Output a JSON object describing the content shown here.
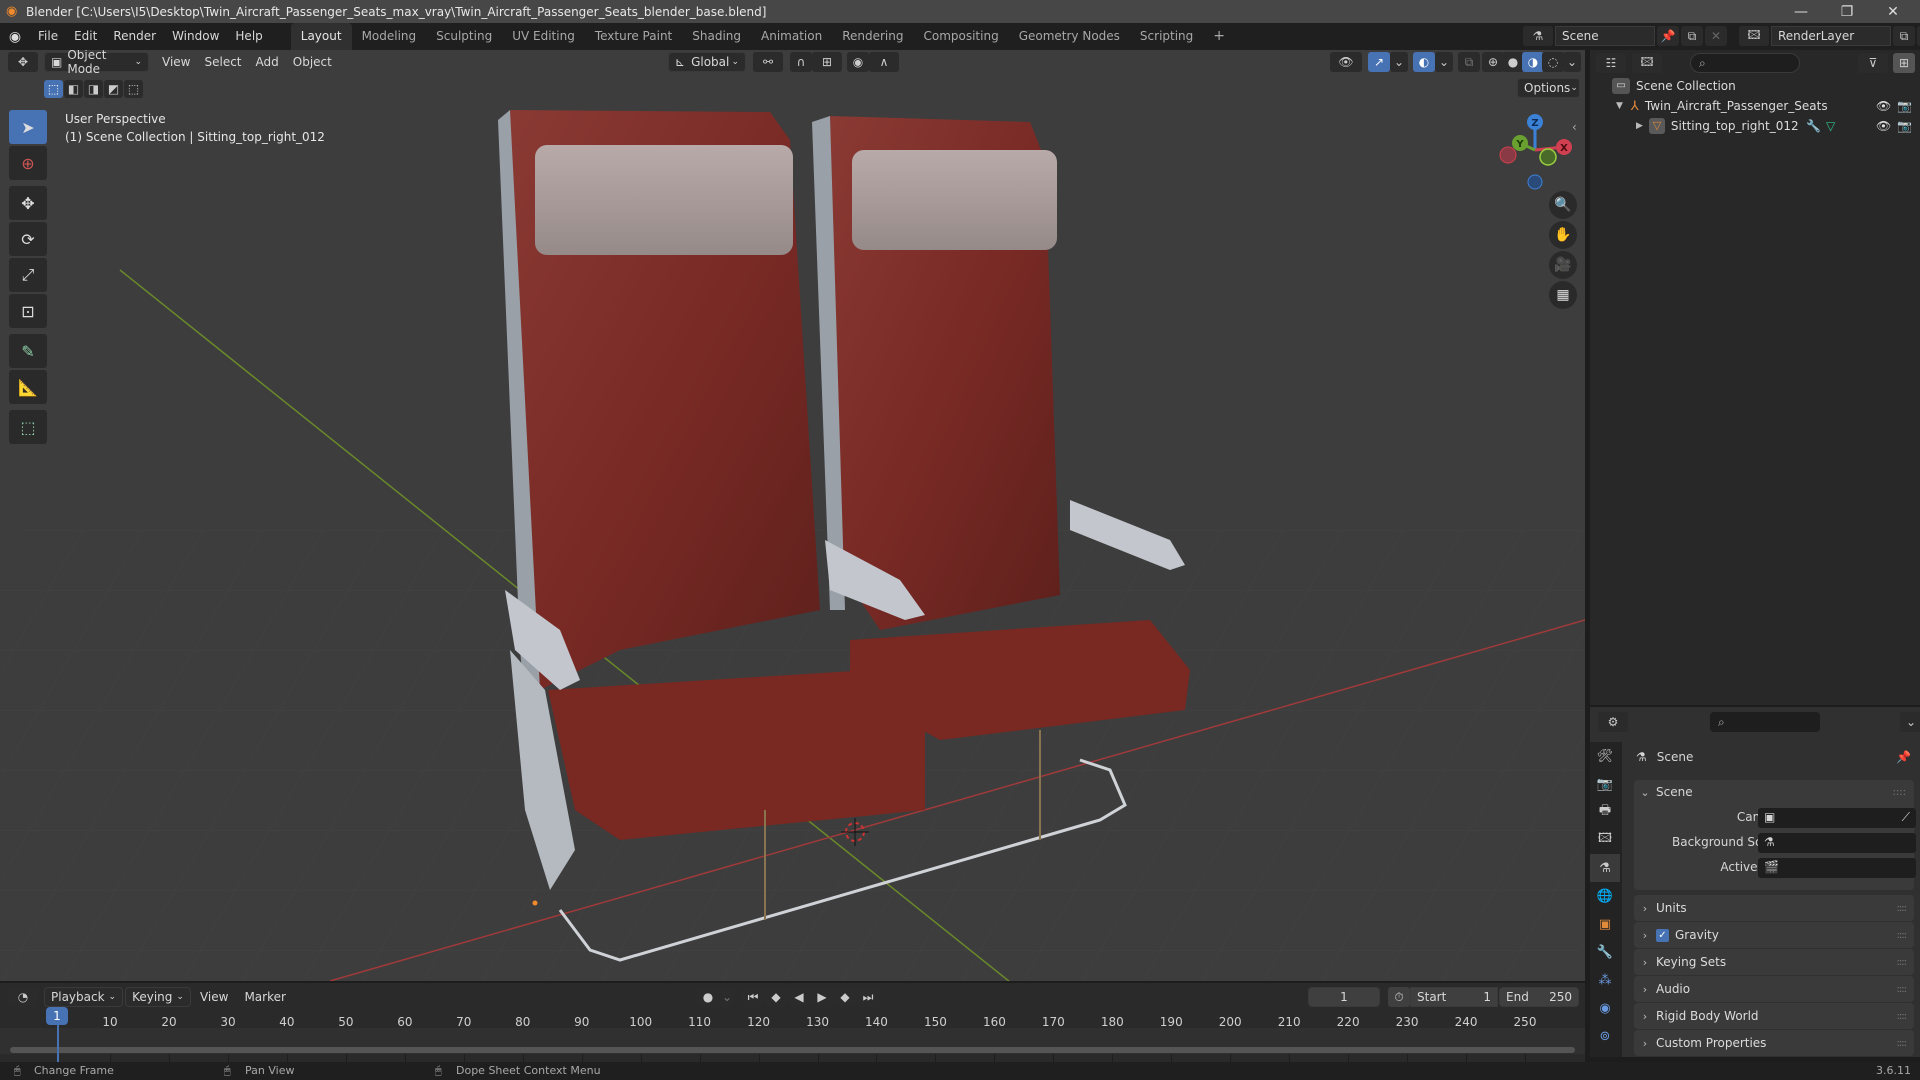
{
  "titlebar": {
    "title": "Blender [C:\\Users\\I5\\Desktop\\Twin_Aircraft_Passenger_Seats_max_vray\\Twin_Aircraft_Passenger_Seats_blender_base.blend]",
    "minimize": "—",
    "maximize": "❐",
    "close": "✕"
  },
  "menubar": {
    "menus": [
      "File",
      "Edit",
      "Render",
      "Window",
      "Help"
    ],
    "workspaces": [
      "Layout",
      "Modeling",
      "Sculpting",
      "UV Editing",
      "Texture Paint",
      "Shading",
      "Animation",
      "Rendering",
      "Compositing",
      "Geometry Nodes",
      "Scripting"
    ],
    "active_workspace": "Layout",
    "add_workspace": "+",
    "scene": "Scene",
    "view_layer": "RenderLayer"
  },
  "viewport": {
    "mode": "Object Mode",
    "menus": [
      "View",
      "Select",
      "Add",
      "Object"
    ],
    "transform_orientation": "Global",
    "options": "Options",
    "overlay_line1": "User Perspective",
    "overlay_line2": "(1) Scene Collection | Sitting_top_right_012",
    "tools": [
      "select-box",
      "cursor",
      "move",
      "rotate",
      "scale",
      "transform",
      "annotate",
      "measure",
      "add-cube"
    ],
    "gizmo_axes": [
      "X",
      "Y",
      "Z"
    ],
    "accent_color": "#4772b3"
  },
  "outliner": {
    "root": "Scene Collection",
    "items": [
      {
        "name": "Twin_Aircraft_Passenger_Seats",
        "type": "empty",
        "expanded": true
      },
      {
        "name": "Sitting_top_right_012",
        "type": "mesh",
        "expanded": false
      }
    ]
  },
  "properties": {
    "context": "Scene",
    "section_scene": "Scene",
    "fields": [
      {
        "label": "Camera",
        "value": ""
      },
      {
        "label": "Background Scene",
        "value": ""
      },
      {
        "label": "Active Clip",
        "value": ""
      }
    ],
    "panels": [
      {
        "label": "Units",
        "checkbox": false
      },
      {
        "label": "Gravity",
        "checkbox": true,
        "checked": true
      },
      {
        "label": "Keying Sets",
        "checkbox": false
      },
      {
        "label": "Audio",
        "checkbox": false
      },
      {
        "label": "Rigid Body World",
        "checkbox": false
      },
      {
        "label": "Custom Properties",
        "checkbox": false
      }
    ]
  },
  "timeline": {
    "menus": [
      "Playback",
      "Keying",
      "View",
      "Marker"
    ],
    "current_frame": "1",
    "start_label": "Start",
    "start": "1",
    "end_label": "End",
    "end": "250",
    "ticks": [
      "1",
      "10",
      "20",
      "30",
      "40",
      "50",
      "60",
      "70",
      "80",
      "90",
      "100",
      "110",
      "120",
      "130",
      "140",
      "150",
      "160",
      "170",
      "180",
      "190",
      "200",
      "210",
      "220",
      "230",
      "240",
      "250"
    ]
  },
  "statusbar": {
    "hints": [
      "Change Frame",
      "Pan View",
      "Dope Sheet Context Menu"
    ],
    "version": "3.6.11"
  }
}
